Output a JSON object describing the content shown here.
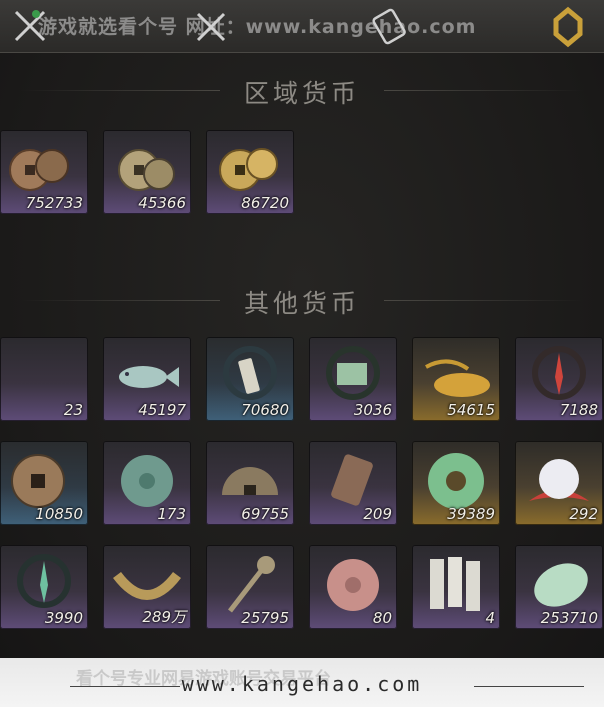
{
  "watermark": {
    "top_text": "游戏就选看个号  网址：www.kangehao.com",
    "bottom_faint_text": "看个号专业网易游戏账号交易平台",
    "bottom_url": "www.kangehao.com"
  },
  "sections": {
    "regional_title": "区域货币",
    "other_title": "其他货币"
  },
  "regional_items": [
    {
      "icon": "bronze-coins-icon",
      "qty": "752733"
    },
    {
      "icon": "silver-coins-icon",
      "qty": "45366"
    },
    {
      "icon": "gold-coins-icon",
      "qty": "86720"
    }
  ],
  "other_items": [
    {
      "icon": "jade-crescent-icon",
      "qty": "23"
    },
    {
      "icon": "jade-fish-icon",
      "qty": "45197"
    },
    {
      "icon": "tablet-token-icon",
      "qty": "70680"
    },
    {
      "icon": "map-scroll-icon",
      "qty": "3036"
    },
    {
      "icon": "grain-pile-icon",
      "qty": "54615"
    },
    {
      "icon": "red-spirit-icon",
      "qty": "7188"
    },
    {
      "icon": "copper-coin-icon",
      "qty": "10850"
    },
    {
      "icon": "jade-disc-icon",
      "qty": "173"
    },
    {
      "icon": "half-coin-icon",
      "qty": "69755"
    },
    {
      "icon": "bronze-plaque-icon",
      "qty": "209"
    },
    {
      "icon": "jade-ring-icon",
      "qty": "39389"
    },
    {
      "icon": "pearl-icon",
      "qty": "292"
    },
    {
      "icon": "green-spirit-icon",
      "qty": "3990"
    },
    {
      "icon": "coin-string-icon",
      "qty": "289万"
    },
    {
      "icon": "sword-coin-icon",
      "qty": "25795"
    },
    {
      "icon": "pink-jade-icon",
      "qty": "80"
    },
    {
      "icon": "paper-notes-icon",
      "qty": "4"
    },
    {
      "icon": "jade-stone-icon",
      "qty": "253710"
    }
  ],
  "colors": {
    "rarity_purple": "#5e4c78",
    "rarity_blue": "#3f6079",
    "rarity_gold": "#8a6c2c",
    "rarity_red": "#7a3e3a"
  }
}
